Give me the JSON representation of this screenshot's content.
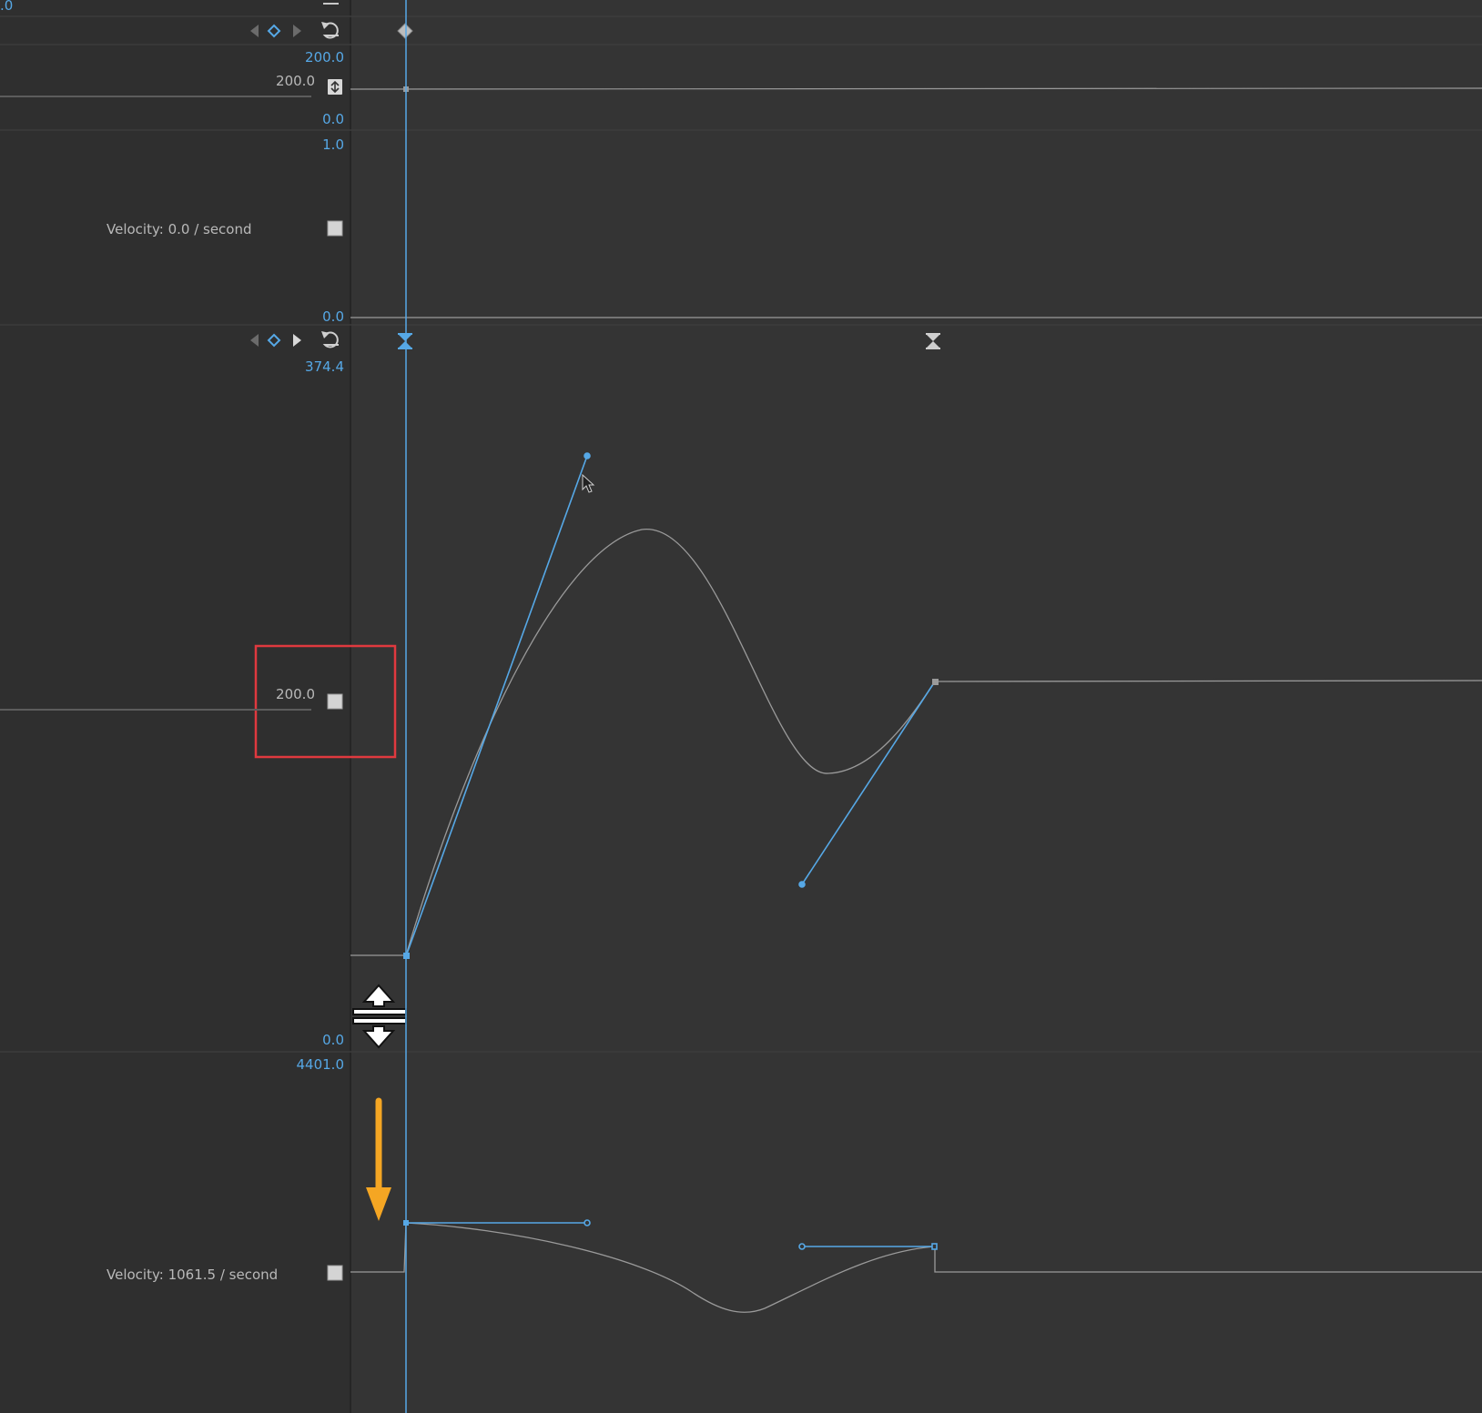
{
  "top_partial": {
    "value": ".0"
  },
  "scale_row": {
    "max": "200.0",
    "value": "200.0",
    "min": "0.0"
  },
  "scale_velocity_row": {
    "max": "1.0",
    "label": "Velocity: 0.0 / second",
    "min": "0.0"
  },
  "position_row": {
    "max": "374.4",
    "value": "200.0",
    "min": "0.0"
  },
  "position_velocity_row": {
    "max": "4401.0",
    "label": "Velocity: 1061.5 / second"
  },
  "icons": {
    "prev_keyframe": "triangle-left-icon",
    "add_keyframe": "diamond-icon",
    "next_keyframe": "triangle-right-icon",
    "reset": "reset-icon",
    "stopwatch": "toggle-animation-icon",
    "bezier_keyframe": "hourglass-keyframe-icon",
    "resize_cursor": "vertical-resize-cursor-icon",
    "annotation_arrow": "orange-down-arrow-icon"
  },
  "colors": {
    "background": "#323232",
    "panel": "#2f2f2f",
    "accent": "#56a8e6",
    "curve": "#9a9a9a",
    "highlight_box": "#e0393f",
    "annotation": "#f5a623"
  }
}
